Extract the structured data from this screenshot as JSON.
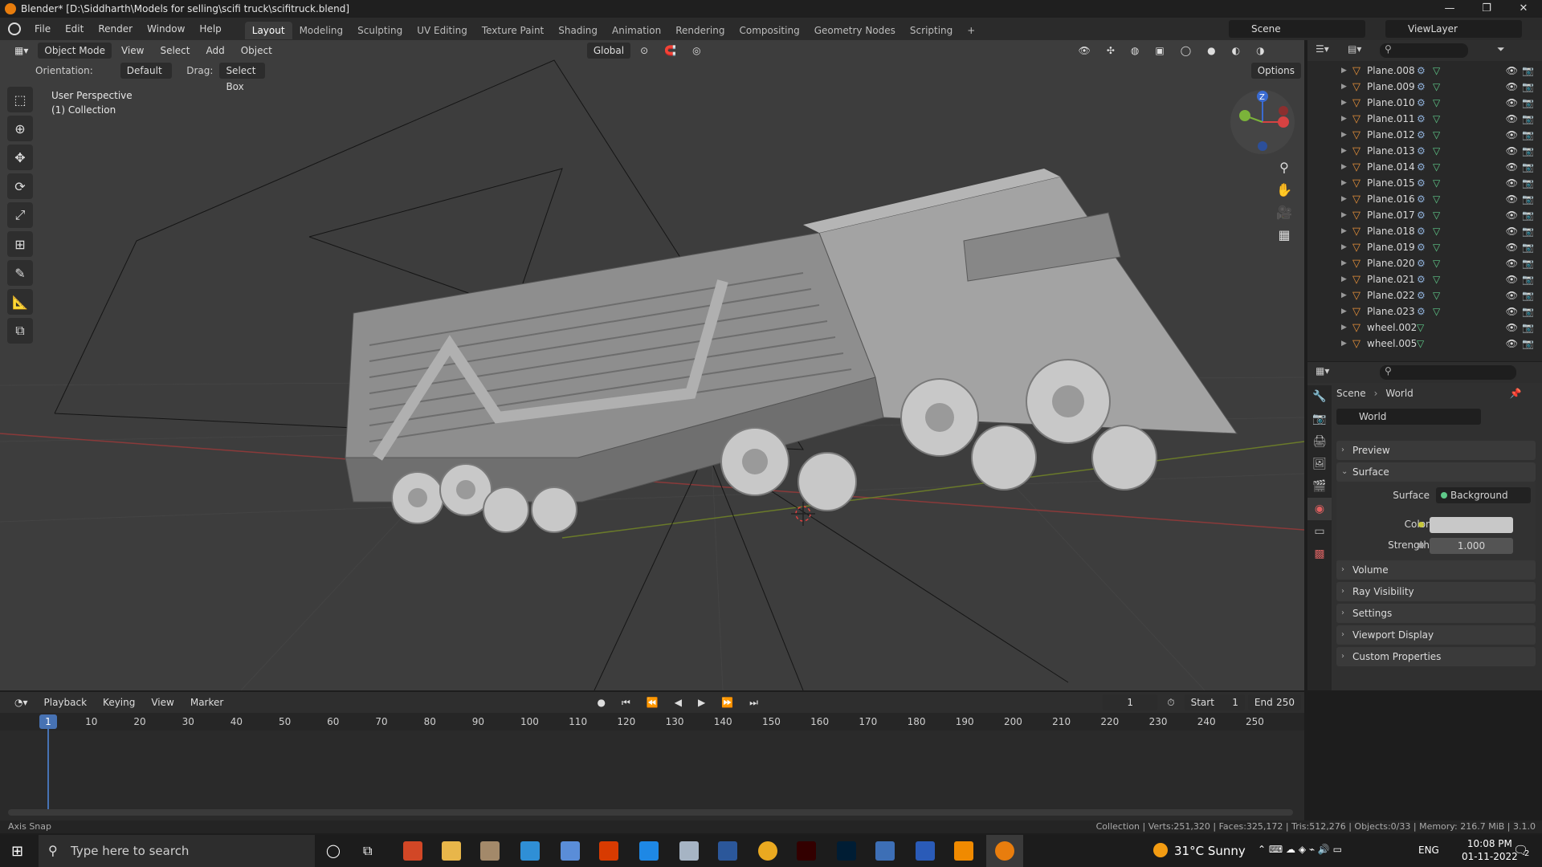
{
  "window": {
    "title": "Blender* [D:\\Siddharth\\Models for selling\\scifi truck\\scifitruck.blend]"
  },
  "menu": [
    "File",
    "Edit",
    "Render",
    "Window",
    "Help"
  ],
  "workspaces": [
    "Layout",
    "Modeling",
    "Sculpting",
    "UV Editing",
    "Texture Paint",
    "Shading",
    "Animation",
    "Rendering",
    "Compositing",
    "Geometry Nodes",
    "Scripting"
  ],
  "workspace_add": "+",
  "scene": "Scene",
  "viewlayer": "ViewLayer",
  "viewport": {
    "mode": "Object Mode",
    "menus": [
      "View",
      "Select",
      "Add",
      "Object"
    ],
    "transform": "Global",
    "orientation_label": "Orientation:",
    "orientation_value": "Default",
    "drag_label": "Drag:",
    "drag_value": "Select Box",
    "options": "Options",
    "info_line1": "User Perspective",
    "info_line2": "(1) Collection"
  },
  "outliner": {
    "items": [
      "Plane.008",
      "Plane.009",
      "Plane.010",
      "Plane.011",
      "Plane.012",
      "Plane.013",
      "Plane.014",
      "Plane.015",
      "Plane.016",
      "Plane.017",
      "Plane.018",
      "Plane.019",
      "Plane.020",
      "Plane.021",
      "Plane.022",
      "Plane.023",
      "wheel.002",
      "wheel.005"
    ]
  },
  "properties": {
    "breadcrumb_scene": "Scene",
    "breadcrumb_world": "World",
    "world_name": "World",
    "panels": [
      "Preview",
      "Surface",
      "Volume",
      "Ray Visibility",
      "Settings",
      "Viewport Display",
      "Custom Properties"
    ],
    "surface_label": "Surface",
    "surface_value": "Background",
    "color_label": "Color",
    "strength_label": "Strength",
    "strength_value": "1.000",
    "color_swatch": "#c8c8c8"
  },
  "timeline": {
    "menus": [
      "Playback",
      "Keying",
      "View",
      "Marker"
    ],
    "current_frame": "1",
    "start_label": "Start",
    "start_value": "1",
    "end_label": "End",
    "end_value": "250",
    "ticks": [
      "10",
      "20",
      "30",
      "40",
      "50",
      "60",
      "70",
      "80",
      "90",
      "100",
      "110",
      "120",
      "130",
      "140",
      "150",
      "160",
      "170",
      "180",
      "190",
      "200",
      "210",
      "220",
      "230",
      "240",
      "250"
    ],
    "marker_frame": "1"
  },
  "statusbar": {
    "left": "Axis Snap",
    "right": "Collection | Verts:251,320 | Faces:325,172 | Tris:512,276 | Objects:0/33 | Memory: 216.7 MiB | 3.1.0"
  },
  "taskbar": {
    "search_placeholder": "Type here to search",
    "weather": "31°C  Sunny",
    "lang": "ENG",
    "time": "10:08 PM",
    "date": "01-11-2022",
    "notif_count": "2"
  },
  "colors": {
    "accent": "#4772b3",
    "object_icon": "#e7913a",
    "mesh_icon": "#5fc989"
  }
}
